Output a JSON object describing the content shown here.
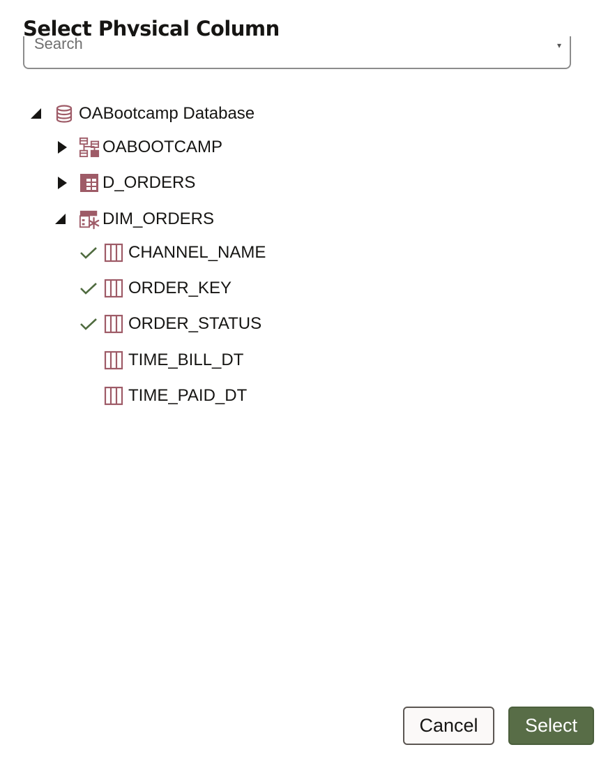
{
  "dialog": {
    "title": "Select Physical Column"
  },
  "search": {
    "placeholder": "Search"
  },
  "tree": {
    "database": {
      "label": "OABootcamp Database",
      "expanded": true,
      "icon": "database-icon"
    },
    "schema": {
      "label": "OABOOTCAMP",
      "expanded": false,
      "icon": "schema-icon"
    },
    "table_d_orders": {
      "label": "D_ORDERS",
      "expanded": false,
      "icon": "table-icon"
    },
    "table_dim_orders": {
      "label": "DIM_ORDERS",
      "expanded": true,
      "icon": "dimension-table-icon"
    },
    "columns": [
      {
        "label": "CHANNEL_NAME",
        "checked": true,
        "icon": "column-icon"
      },
      {
        "label": "ORDER_KEY",
        "checked": true,
        "icon": "column-icon"
      },
      {
        "label": "ORDER_STATUS",
        "checked": true,
        "icon": "column-icon"
      },
      {
        "label": "TIME_BILL_DT",
        "checked": false,
        "icon": "column-icon"
      },
      {
        "label": "TIME_PAID_DT",
        "checked": false,
        "icon": "column-icon"
      }
    ]
  },
  "buttons": {
    "cancel": "Cancel",
    "select": "Select"
  },
  "colors": {
    "icon": "#9e5b67",
    "check": "#4f6b3f",
    "primary_button": "#586d47",
    "text": "#161513"
  }
}
